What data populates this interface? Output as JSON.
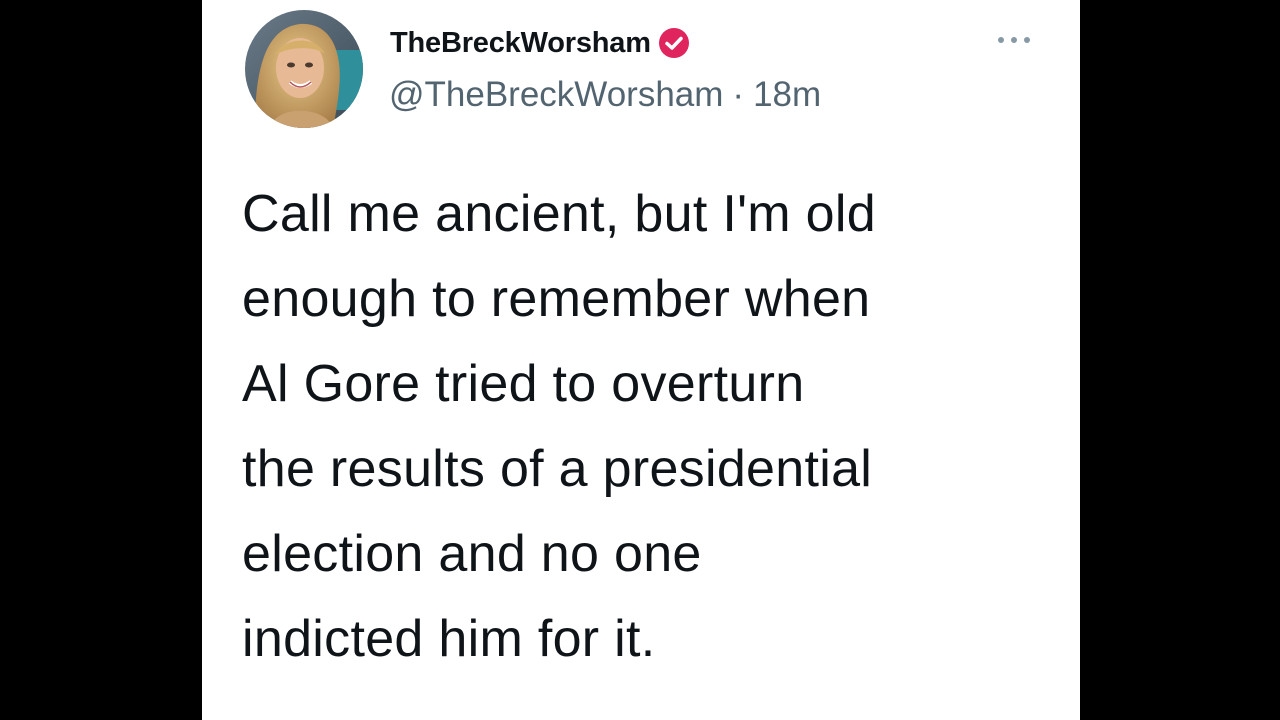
{
  "tweet": {
    "author": {
      "display_name": "TheBreckWorsham",
      "handle": "@TheBreckWorsham",
      "verified_icon": "verified-check-icon",
      "avatar_icon": "profile-photo"
    },
    "separator": "·",
    "timestamp": "18m",
    "more_icon": "more-options-icon",
    "body_lines": [
      "Call me ancient, but I'm old",
      "enough to remember when",
      "Al Gore tried to overturn",
      "the results of a presidential",
      "election and no one",
      "indicted him for it."
    ]
  },
  "colors": {
    "background": "#000000",
    "card": "#ffffff",
    "text_primary": "#0f1419",
    "text_secondary": "#536471",
    "verified_badge": "#e0245e"
  }
}
